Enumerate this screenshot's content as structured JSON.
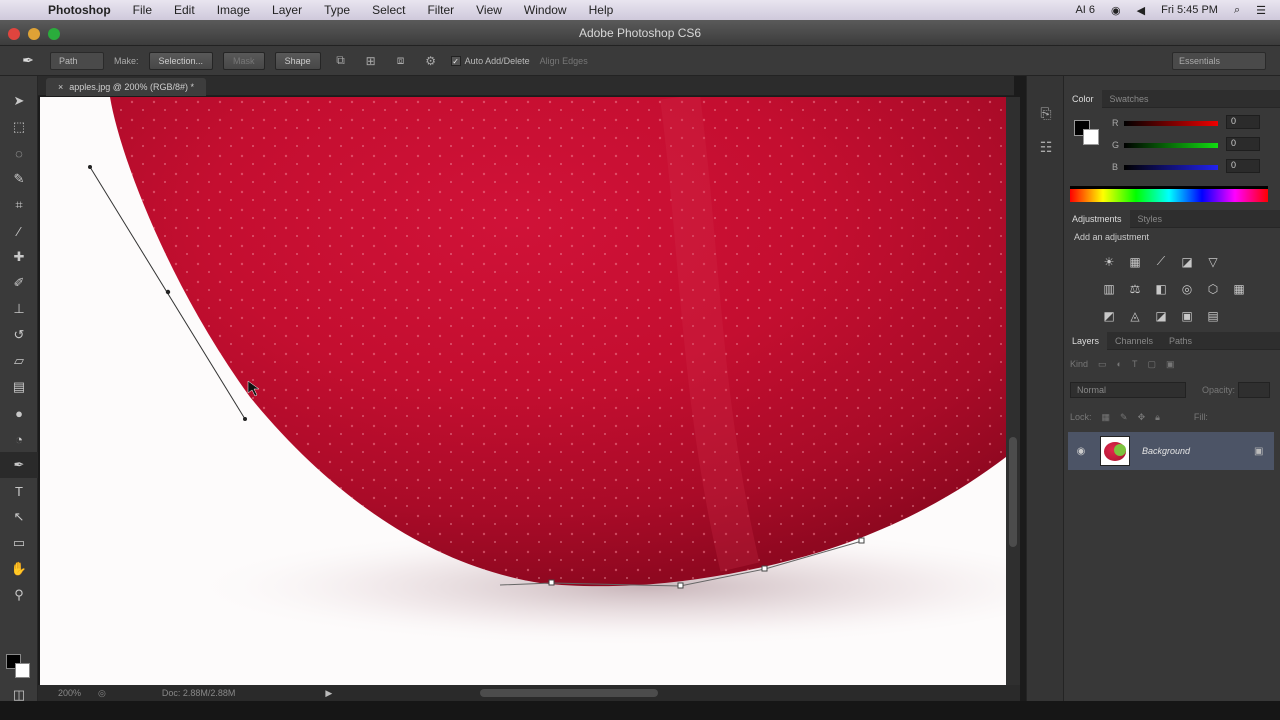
{
  "menubar": {
    "app_name": "Photoshop",
    "items": [
      "File",
      "Edit",
      "Image",
      "Layer",
      "Type",
      "Select",
      "Filter",
      "View",
      "Window",
      "Help"
    ],
    "status_icons": [
      "AI 6",
      "Fri 5:45 PM"
    ]
  },
  "window": {
    "title": "Adobe Photoshop CS6"
  },
  "options_bar": {
    "mode_select": "Path",
    "make_label": "Make:",
    "selection_button": "Selection...",
    "mask_button": "Mask",
    "shape_button": "Shape",
    "auto_add_delete_label": "Auto Add/Delete",
    "align_edges_label": "Align Edges",
    "workspace_select": "Essentials"
  },
  "document": {
    "tab_label": "apples.jpg @ 200% (RGB/8#) *"
  },
  "status": {
    "zoom": "200%",
    "doc_size": "Doc: 2.88M/2.88M"
  },
  "panels": {
    "color_tabs": [
      "Color",
      "Swatches"
    ],
    "color_sliders": [
      {
        "label": "R",
        "value": "0"
      },
      {
        "label": "G",
        "value": "0"
      },
      {
        "label": "B",
        "value": "0"
      }
    ],
    "adjustment_tabs": [
      "Adjustments",
      "Styles"
    ],
    "adjustment_title": "Add an adjustment",
    "layer_tabs": [
      "Layers",
      "Channels",
      "Paths"
    ],
    "filter_kind": "Kind",
    "blend_mode": "Normal",
    "opacity_label": "Opacity:",
    "lock_label": "Lock:",
    "fill_label": "Fill:",
    "layer_name": "Background"
  },
  "colors": {
    "apple_red": "#c8102e",
    "panel_bg": "#383838",
    "selected_layer": "#4c5466"
  }
}
